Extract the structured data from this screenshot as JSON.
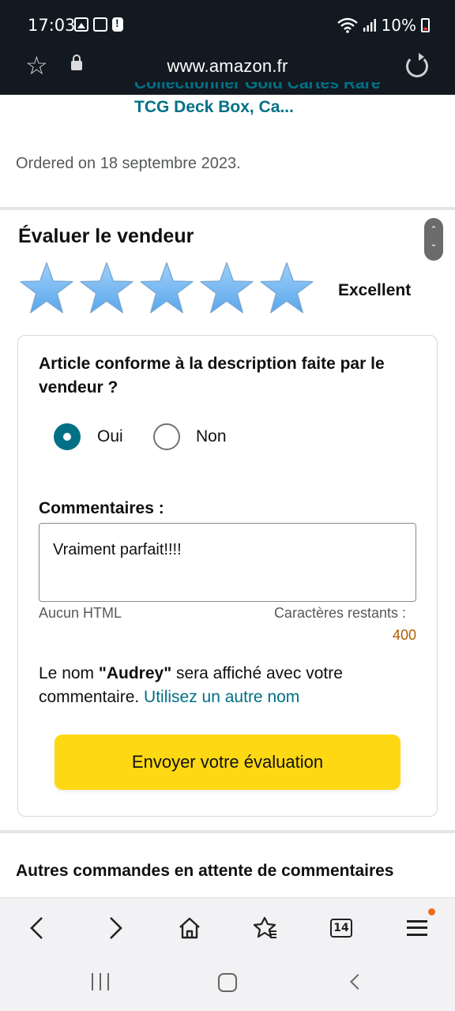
{
  "status_bar": {
    "time": "17:03",
    "battery": "10%"
  },
  "browser": {
    "url": "www.amazon.fr"
  },
  "product": {
    "title_line1": "Collectionner Gold Cartes Rare",
    "title_line2": "TCG Deck Box, Ca...",
    "ordered": "Ordered on 18 septembre 2023."
  },
  "rating": {
    "heading": "Évaluer le vendeur",
    "stars": 5,
    "max_stars": 5,
    "label": "Excellent"
  },
  "form": {
    "question": "Article conforme à la description faite par le vendeur ?",
    "option_yes": "Oui",
    "option_no": "Non",
    "selected": "Oui",
    "comments_label": "Commentaires :",
    "comment_value": "Vraiment parfait!!!!",
    "no_html": "Aucun HTML",
    "remaining_label": "Caractères restants :",
    "remaining_count": "400",
    "name_prefix": "Le nom ",
    "name_value": "\"Audrey\"",
    "name_suffix": " sera affiché avec votre commentaire. ",
    "other_name_link": "Utilisez un autre nom",
    "submit_label": "Envoyer votre évaluation"
  },
  "pending_heading": "Autres commandes en attente de commentaires",
  "toolbar": {
    "tabs_count": "14"
  },
  "colors": {
    "header_bg": "#131921",
    "link": "#007185",
    "button": "#ffd814",
    "star": "#5aa7ea"
  },
  "icons": [
    "star-outline-icon",
    "lock-icon",
    "reload-icon",
    "back-icon",
    "forward-icon",
    "home-icon",
    "bookmarks-icon",
    "tabs-icon",
    "menu-icon"
  ]
}
